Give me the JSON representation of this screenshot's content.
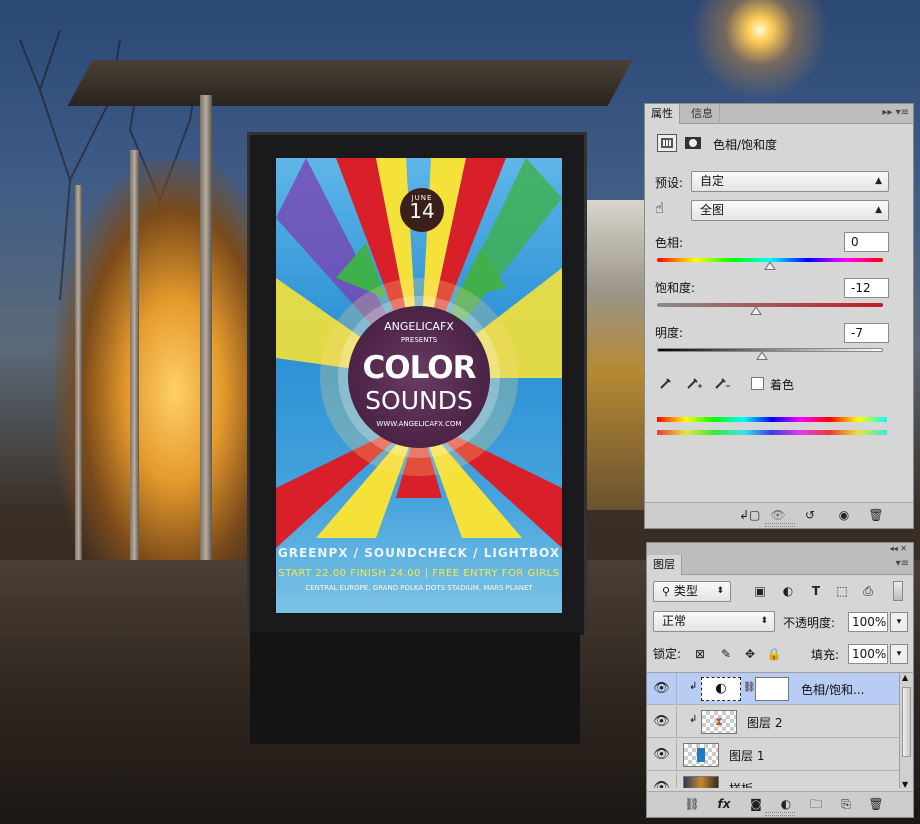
{
  "poster": {
    "month": "JUNE",
    "day": "14",
    "brand": "ANGELICAFX",
    "presents": "PRESENTS",
    "title_line1": "COLOR",
    "title_line2": "SOUNDS",
    "url": "WWW.ANGELICAFX.COM",
    "lineup": "GREENPX / SOUNDCHECK / LIGHTBOX",
    "info": "START 22.00 FINISH 24.00 | FREE ENTRY FOR GIRLS",
    "venue": "CENTRAL EUROPE, GRAND POLKA DOTS STADIUM, MARS PLANET"
  },
  "properties_panel": {
    "tabs": [
      "属性",
      "信息"
    ],
    "title": "色相/饱和度",
    "preset_label": "预设:",
    "preset_value": "自定",
    "channel_value": "全图",
    "hue_label": "色相:",
    "hue_value": "0",
    "saturation_label": "饱和度:",
    "saturation_value": "-12",
    "lightness_label": "明度:",
    "lightness_value": "-7",
    "colorize_label": "着色",
    "colorize_checked": false,
    "slider_levels": {
      "hue": 0,
      "saturation": -12,
      "lightness": -7
    }
  },
  "layers_panel": {
    "tab": "图层",
    "filter_kind": "类型",
    "blend_mode": "正常",
    "opacity_label": "不透明度:",
    "opacity_value": "100%",
    "lock_label": "锁定:",
    "fill_label": "填充:",
    "fill_value": "100%",
    "layers": [
      {
        "name": "色相/饱和...",
        "selected": true,
        "clipped": true,
        "type": "adjustment"
      },
      {
        "name": "图层 2",
        "selected": false,
        "clipped": true,
        "type": "pixel"
      },
      {
        "name": "图层 1",
        "selected": false,
        "clipped": false,
        "type": "pixel"
      },
      {
        "name": "样板",
        "selected": false,
        "clipped": false,
        "type": "image"
      }
    ]
  },
  "colors": {
    "panel_bg": "#d6d6d6",
    "selected_row": "#b8ccf4",
    "poster_red": "#d9202a",
    "poster_yellow": "#f4e23a",
    "poster_blue": "#2a8fd4"
  },
  "icons": {
    "adjustment_type": "hue-saturation-icon",
    "mask": "mask-icon",
    "targeted_adjust": "hand-targeted-adjust-icon",
    "eyedroppers": [
      "eyedropper-icon",
      "eyedropper-plus-icon",
      "eyedropper-minus-icon"
    ],
    "properties_footer": [
      "clip-to-layer-icon",
      "view-previous-icon",
      "reset-icon",
      "visibility-icon",
      "trash-icon"
    ],
    "layers_footer": [
      "link-icon",
      "fx-icon",
      "add-mask-icon",
      "new-adjustment-icon",
      "new-group-icon",
      "new-layer-icon",
      "trash-icon"
    ]
  }
}
